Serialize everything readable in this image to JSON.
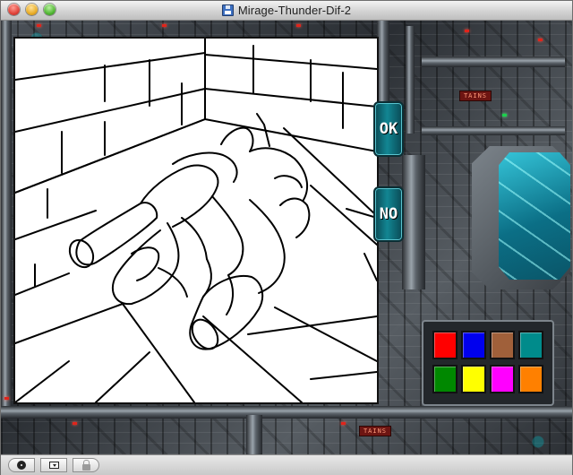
{
  "window": {
    "title": "Mirage-Thunder-Dif-2",
    "title_icon": "floppy-disk-icon"
  },
  "controls": {
    "ok_label": "OK",
    "no_label": "NO"
  },
  "palette": {
    "colors": [
      "#ff0000",
      "#0000ee",
      "#a0603a",
      "#008b8b",
      "#008800",
      "#ffff00",
      "#ff00ff",
      "#ff8000"
    ]
  },
  "panel_plates": [
    "TAINS",
    "TAINS"
  ],
  "statusbar": {
    "icons": [
      "zoom-icon",
      "screen-icon",
      "lock-icon"
    ]
  }
}
